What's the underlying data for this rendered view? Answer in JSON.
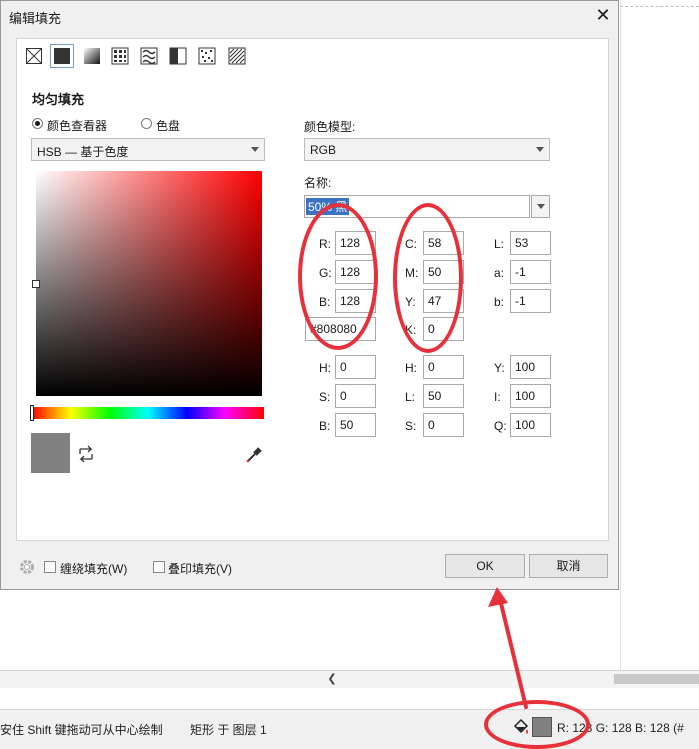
{
  "dialog": {
    "title": "编辑填充",
    "close_glyph": "✕",
    "section_title": "均匀填充",
    "fill_types": [
      "no-fill",
      "uniform-fill",
      "fountain-fill",
      "vector-pattern-fill",
      "bitmap-pattern-fill",
      "two-color-pattern-fill",
      "texture-fill",
      "postscript-fill"
    ]
  },
  "left": {
    "radio_viewer": "颜色查看器",
    "radio_palette": "色盘",
    "mode_dropdown": "HSB — 基于色度"
  },
  "right": {
    "model_label": "颜色模型:",
    "model_value": "RGB",
    "name_label": "名称:",
    "name_value": "50% 黑",
    "rgb": {
      "r_label": "R:",
      "r": "128",
      "g_label": "G:",
      "g": "128",
      "b_label": "B:",
      "b": "128"
    },
    "hex": "#808080",
    "cmyk": {
      "c_label": "C:",
      "c": "58",
      "m_label": "M:",
      "m": "50",
      "y_label": "Y:",
      "y": "47",
      "k_label": "K:",
      "k": "0"
    },
    "lab": {
      "l_label": "L:",
      "l": "53",
      "a_label": "a:",
      "a": "-1",
      "b_label": "b:",
      "b": "-1"
    },
    "hsb": {
      "h_label": "H:",
      "h": "0",
      "s_label": "S:",
      "s": "0",
      "b_label": "B:",
      "b": "50"
    },
    "hls": {
      "h_label": "H:",
      "h": "0",
      "l_label": "L:",
      "l": "50",
      "s_label": "S:",
      "s": "0"
    },
    "yiq": {
      "y_label": "Y:",
      "y": "100",
      "i_label": "I:",
      "i": "100",
      "q_label": "Q:",
      "q": "100"
    }
  },
  "footer": {
    "wrap_fill": "缠绕填充(W)",
    "overprint_fill": "叠印填充(V)",
    "ok": "OK",
    "cancel": "取消"
  },
  "status": {
    "hint": "安住 Shift 键拖动可从中心绘制",
    "object": "矩形 于 图层 1",
    "rgb_readout": "R:   128 G:   128 B:   128 (#"
  },
  "colors": {
    "current_fill": "#808080",
    "annotation_red": "#e8303a"
  }
}
